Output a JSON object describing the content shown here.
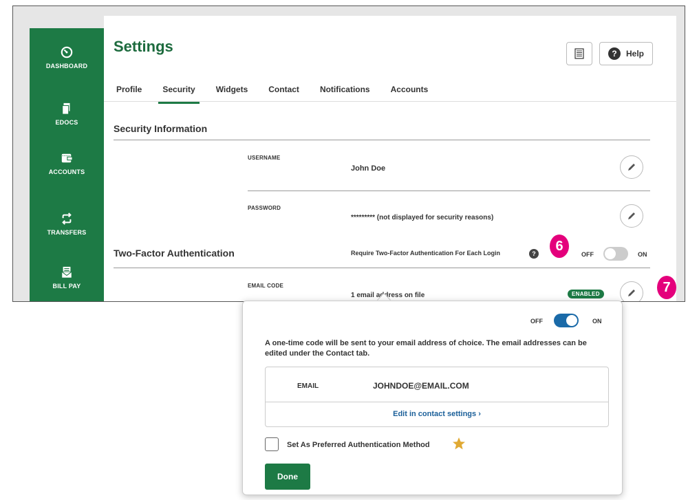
{
  "sidebar": {
    "items": [
      {
        "label": "DASHBOARD",
        "icon": "dashboard-icon"
      },
      {
        "label": "EDOCS",
        "icon": "documents-icon"
      },
      {
        "label": "ACCOUNTS",
        "icon": "wallet-icon"
      },
      {
        "label": "TRANSFERS",
        "icon": "transfer-arrows-icon"
      },
      {
        "label": "BILL PAY",
        "icon": "bill-envelope-icon"
      }
    ]
  },
  "header": {
    "title": "Settings",
    "print_icon": "print-icon",
    "help_label": "Help"
  },
  "tabs": [
    {
      "label": "Profile"
    },
    {
      "label": "Security"
    },
    {
      "label": "Widgets"
    },
    {
      "label": "Contact"
    },
    {
      "label": "Notifications"
    },
    {
      "label": "Accounts"
    }
  ],
  "active_tab": "Security",
  "security_info": {
    "heading": "Security Information",
    "username_label": "USERNAME",
    "username_value": "John Doe",
    "password_label": "PASSWORD",
    "password_value": "********* (not displayed for security reasons)"
  },
  "two_factor": {
    "heading": "Two-Factor Authentication",
    "require_text": "Require Two-Factor Authentication For Each Login",
    "off_label": "OFF",
    "on_label": "ON",
    "toggle_state": "off",
    "email_code_label": "EMAIL CODE",
    "email_code_value": "1 email address on file",
    "status_badge": "ENABLED"
  },
  "callouts": {
    "six": "6",
    "seven": "7"
  },
  "popup": {
    "off_label": "OFF",
    "on_label": "ON",
    "toggle_state": "on",
    "description": "A one-time code will be sent to your email address of choice. The email addresses can be edited under the Contact tab.",
    "email_label": "EMAIL",
    "email_value": "JOHNDOE@EMAIL.COM",
    "edit_link": "Edit in contact settings ›",
    "preferred_label": "Set As Preferred Authentication Method",
    "star_icon": "star-icon",
    "done_label": "Done"
  },
  "colors": {
    "brand_green": "#1d7a45",
    "toggle_blue": "#1a6aa8",
    "callout_magenta": "#e4007c",
    "star_gold": "#e0a933"
  }
}
